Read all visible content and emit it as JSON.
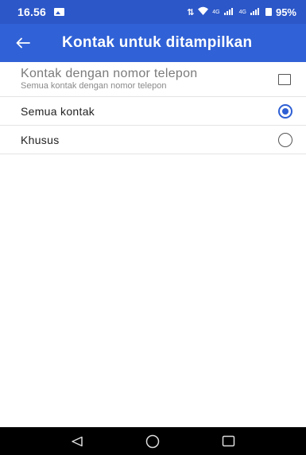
{
  "status_bar": {
    "time": "16.56",
    "net_label_1": "4G",
    "net_label_2": "4G",
    "battery": "95%"
  },
  "app_bar": {
    "title": "Kontak untuk ditampilkan"
  },
  "settings": [
    {
      "title": "Kontak dengan nomor telepon",
      "subtitle": "Semua kontak dengan nomor telepon",
      "control": "checkbox",
      "checked": false
    },
    {
      "title": "Semua kontak",
      "control": "radio",
      "checked": true
    },
    {
      "title": "Khusus",
      "control": "radio",
      "checked": false
    }
  ],
  "colors": {
    "status_bar": "#2c57c8",
    "app_bar": "#3061d6",
    "accent": "#2e5fd4"
  }
}
